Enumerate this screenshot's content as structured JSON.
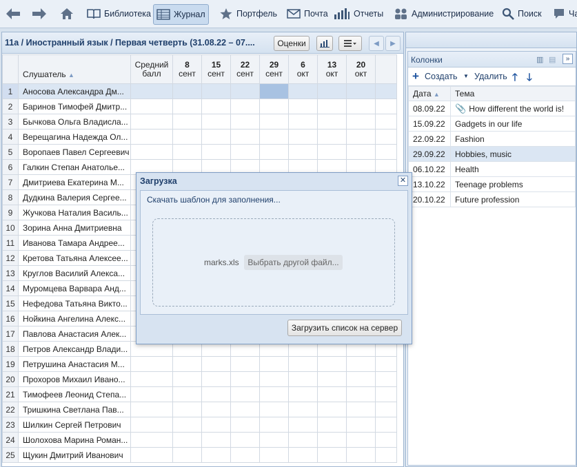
{
  "toolbar": {
    "items": [
      {
        "label": "Библиотека"
      },
      {
        "label": "Журнал"
      },
      {
        "label": "Портфель"
      },
      {
        "label": "Почта"
      },
      {
        "label": "Отчеты"
      },
      {
        "label": "Администрирование"
      },
      {
        "label": "Поиск"
      },
      {
        "label": "Ча"
      }
    ]
  },
  "journal": {
    "title": "11а / Иностранный язык / Первая четверть (31.08.22 – 07....",
    "grades_button": "Оценки",
    "columns": {
      "num": "",
      "name": "Слушатель",
      "avg_line1": "Средний",
      "avg_line2": "балл"
    },
    "dates": [
      {
        "d": "8",
        "m": "сент"
      },
      {
        "d": "15",
        "m": "сент"
      },
      {
        "d": "22",
        "m": "сент"
      },
      {
        "d": "29",
        "m": "сент"
      },
      {
        "d": "6",
        "m": "окт"
      },
      {
        "d": "13",
        "m": "окт"
      },
      {
        "d": "20",
        "m": "окт"
      }
    ],
    "students": [
      "Аносова Александра Дм...",
      "Баринов Тимофей Дмитр...",
      "Бычкова Ольга Владисла...",
      "Верещагина Надежда Ол...",
      "Воропаев Павел Сергеевич",
      "Галкин Степан Анатолье...",
      "Дмитриева Екатерина М...",
      "Дудкина Валерия Сергее...",
      "Жучкова Наталия Василь...",
      "Зорина Анна Дмитриевна",
      "Иванова Тамара Андрее...",
      "Кретова Татьяна Алексее...",
      "Круглов Василий Алекса...",
      "Муромцева Варвара Анд...",
      "Нефедова Татьяна Викто...",
      "Нойкина Ангелина Алекс...",
      "Павлова Анастасия Алек...",
      "Петров Александр Влади...",
      "Петрушина Анастасия М...",
      "Прохоров Михаил Ивано...",
      "Тимофеев Леонид Степа...",
      "Тришкина Светлана Пав...",
      "Шилкин Сергей Петрович",
      "Шолохова Марина Роман...",
      "Щукин Дмитрий Иванович"
    ]
  },
  "columns_panel": {
    "title": "Колонки",
    "create": "Создать",
    "delete": "Удалить",
    "headers": {
      "date": "Дата",
      "topic": "Тема"
    },
    "rows": [
      {
        "date": "08.09.22",
        "topic": "How different the world is!"
      },
      {
        "date": "15.09.22",
        "topic": "Gadgets in our life"
      },
      {
        "date": "22.09.22",
        "topic": "Fashion"
      },
      {
        "date": "29.09.22",
        "topic": "Hobbies, music"
      },
      {
        "date": "06.10.22",
        "topic": "Health"
      },
      {
        "date": "13.10.22",
        "topic": "Teenage problems"
      },
      {
        "date": "20.10.22",
        "topic": "Future profession"
      }
    ]
  },
  "dialog": {
    "title": "Загрузка",
    "template_link": "Скачать шаблон для заполнения...",
    "file_name": "marks.xls",
    "pick_button": "Выбрать другой файл...",
    "upload_button": "Загрузить список на сервер"
  },
  "colors": {
    "accent": "#1f3f6b",
    "selection": "#dbe6f3",
    "date_highlight": "#2255cc"
  }
}
